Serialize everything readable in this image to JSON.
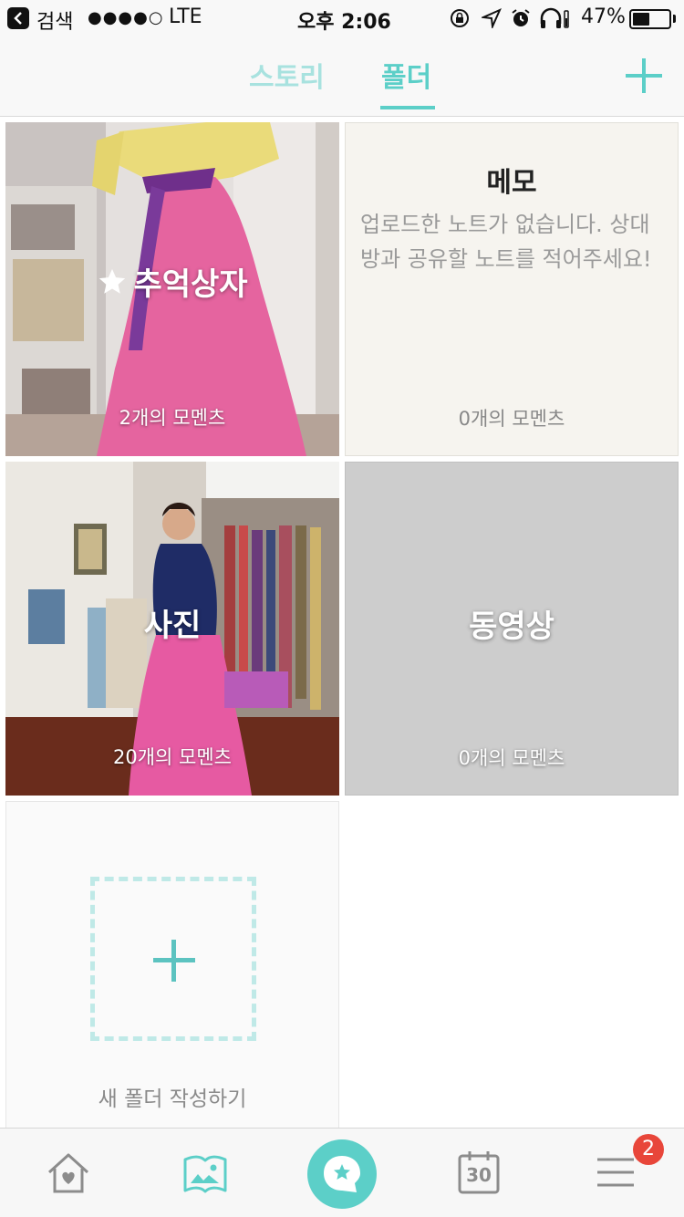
{
  "status_bar": {
    "back_app": "검색",
    "signal": "●●●●○",
    "network": "LTE",
    "time": "오후 2:06",
    "battery": "47%",
    "battery_level": 0.47
  },
  "top_nav": {
    "tabs": [
      {
        "label": "스토리",
        "active": false
      },
      {
        "label": "폴더",
        "active": true
      }
    ],
    "add_icon": "plus-icon"
  },
  "folders": [
    {
      "title": "추억상자",
      "count": "2개의 모멘츠",
      "icon": "star-icon"
    },
    {
      "title": "메모",
      "description": "업로드한 노트가 없습니다. 상대방과 공유할 노트를 적어주세요!",
      "count": "0개의 모멘츠"
    },
    {
      "title": "사진",
      "count": "20개의 모멘츠"
    },
    {
      "title": "동영상",
      "count": "0개의 모멘츠"
    }
  ],
  "new_folder": {
    "label": "새 폴더 작성하기"
  },
  "bottom_bar": {
    "items": [
      "home-heart-icon",
      "photo-album-icon",
      "star-chat-icon",
      "calendar-icon",
      "menu-icon"
    ],
    "calendar_day": "30",
    "menu_badge": "2"
  },
  "colors": {
    "accent": "#5ccfc8",
    "accent_light": "#a8e2df",
    "badge": "#e8463a"
  }
}
